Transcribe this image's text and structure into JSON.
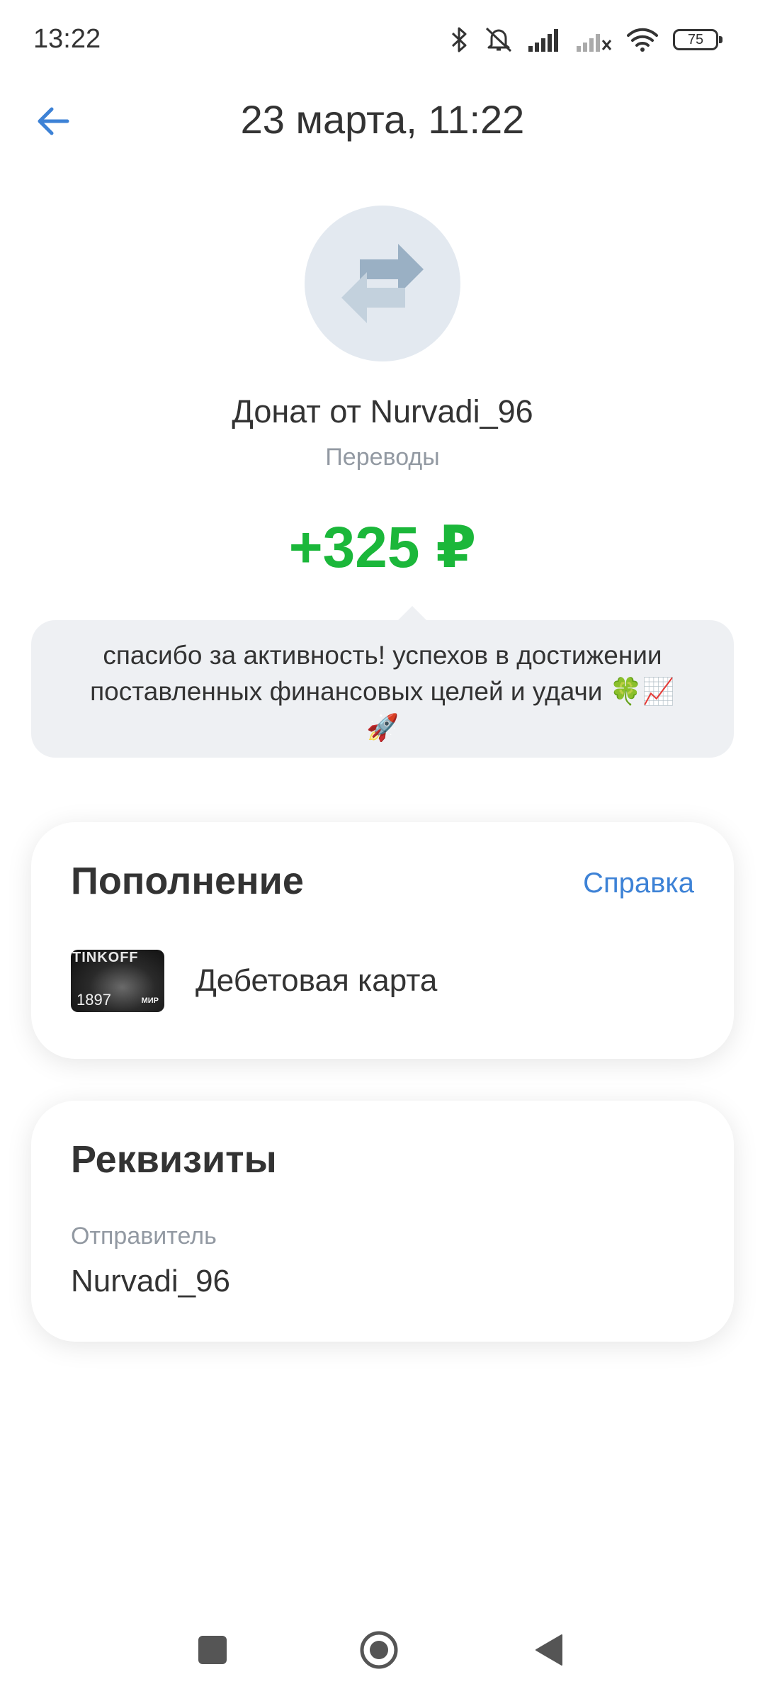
{
  "status_bar": {
    "time": "13:22",
    "battery": "75",
    "icons": [
      "bluetooth-icon",
      "mute-icon",
      "signal-icon",
      "signal-off-icon",
      "wifi-icon",
      "battery-icon"
    ]
  },
  "header": {
    "title": "23 марта, 11:22",
    "back_icon": "arrow-left-icon"
  },
  "operation": {
    "icon": "transfer-icon",
    "title": "Донат от Nurvadi_96",
    "category": "Переводы",
    "amount": "+325 ₽",
    "amount_color": "#1bb73a",
    "message_line1": "спасибо за активность! успехов в достижении",
    "message_line2": "поставленных финансовых целей и удачи 🍀📈",
    "message_line3": "🚀"
  },
  "topup": {
    "title": "Пополнение",
    "help_link": "Справка",
    "card_thumb_brand": "TINKOFF",
    "card_thumb_number": "1897",
    "card_thumb_payment": "МИР",
    "card_name": "Дебетовая карта"
  },
  "details": {
    "title": "Реквизиты",
    "sender_label": "Отправитель",
    "sender_value": "Nurvadi_96"
  },
  "nav_bar": {
    "icons": [
      "recents-icon",
      "home-icon",
      "back-icon"
    ]
  },
  "colors": {
    "accent": "#3d82d6",
    "positive": "#1bb73a",
    "bubble": "#eef0f3",
    "icon_bg": "#e3e9f0"
  }
}
